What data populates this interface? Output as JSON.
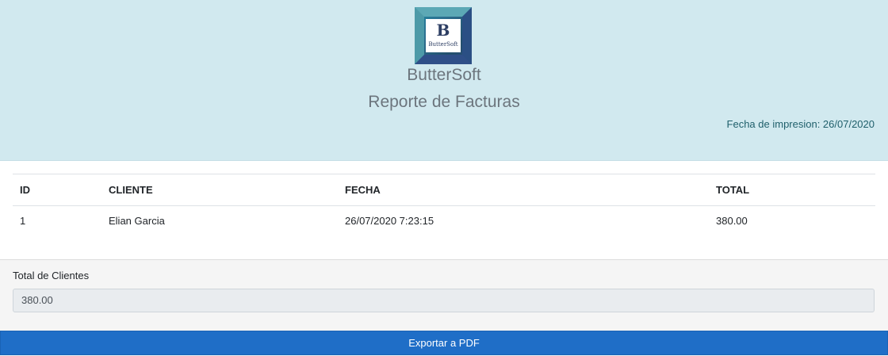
{
  "header": {
    "logo": {
      "letter": "B",
      "word": "ButterSoft"
    },
    "company_name": "ButterSoft",
    "report_title": "Reporte de Facturas",
    "print_date": "Fecha de impresion: 26/07/2020"
  },
  "table": {
    "columns": [
      "ID",
      "CLIENTE",
      "FECHA",
      "TOTAL"
    ],
    "rows": [
      [
        "1",
        "Elian Garcia",
        "26/07/2020 7:23:15",
        "380.00"
      ]
    ]
  },
  "footer": {
    "total_label": "Total de Clientes",
    "total_value": "380.00",
    "export_label": "Exportar a PDF"
  },
  "colors": {
    "header_background": "#d1e9ef",
    "button_background": "#1f6ec7",
    "footer_background": "#f5f5f5"
  }
}
